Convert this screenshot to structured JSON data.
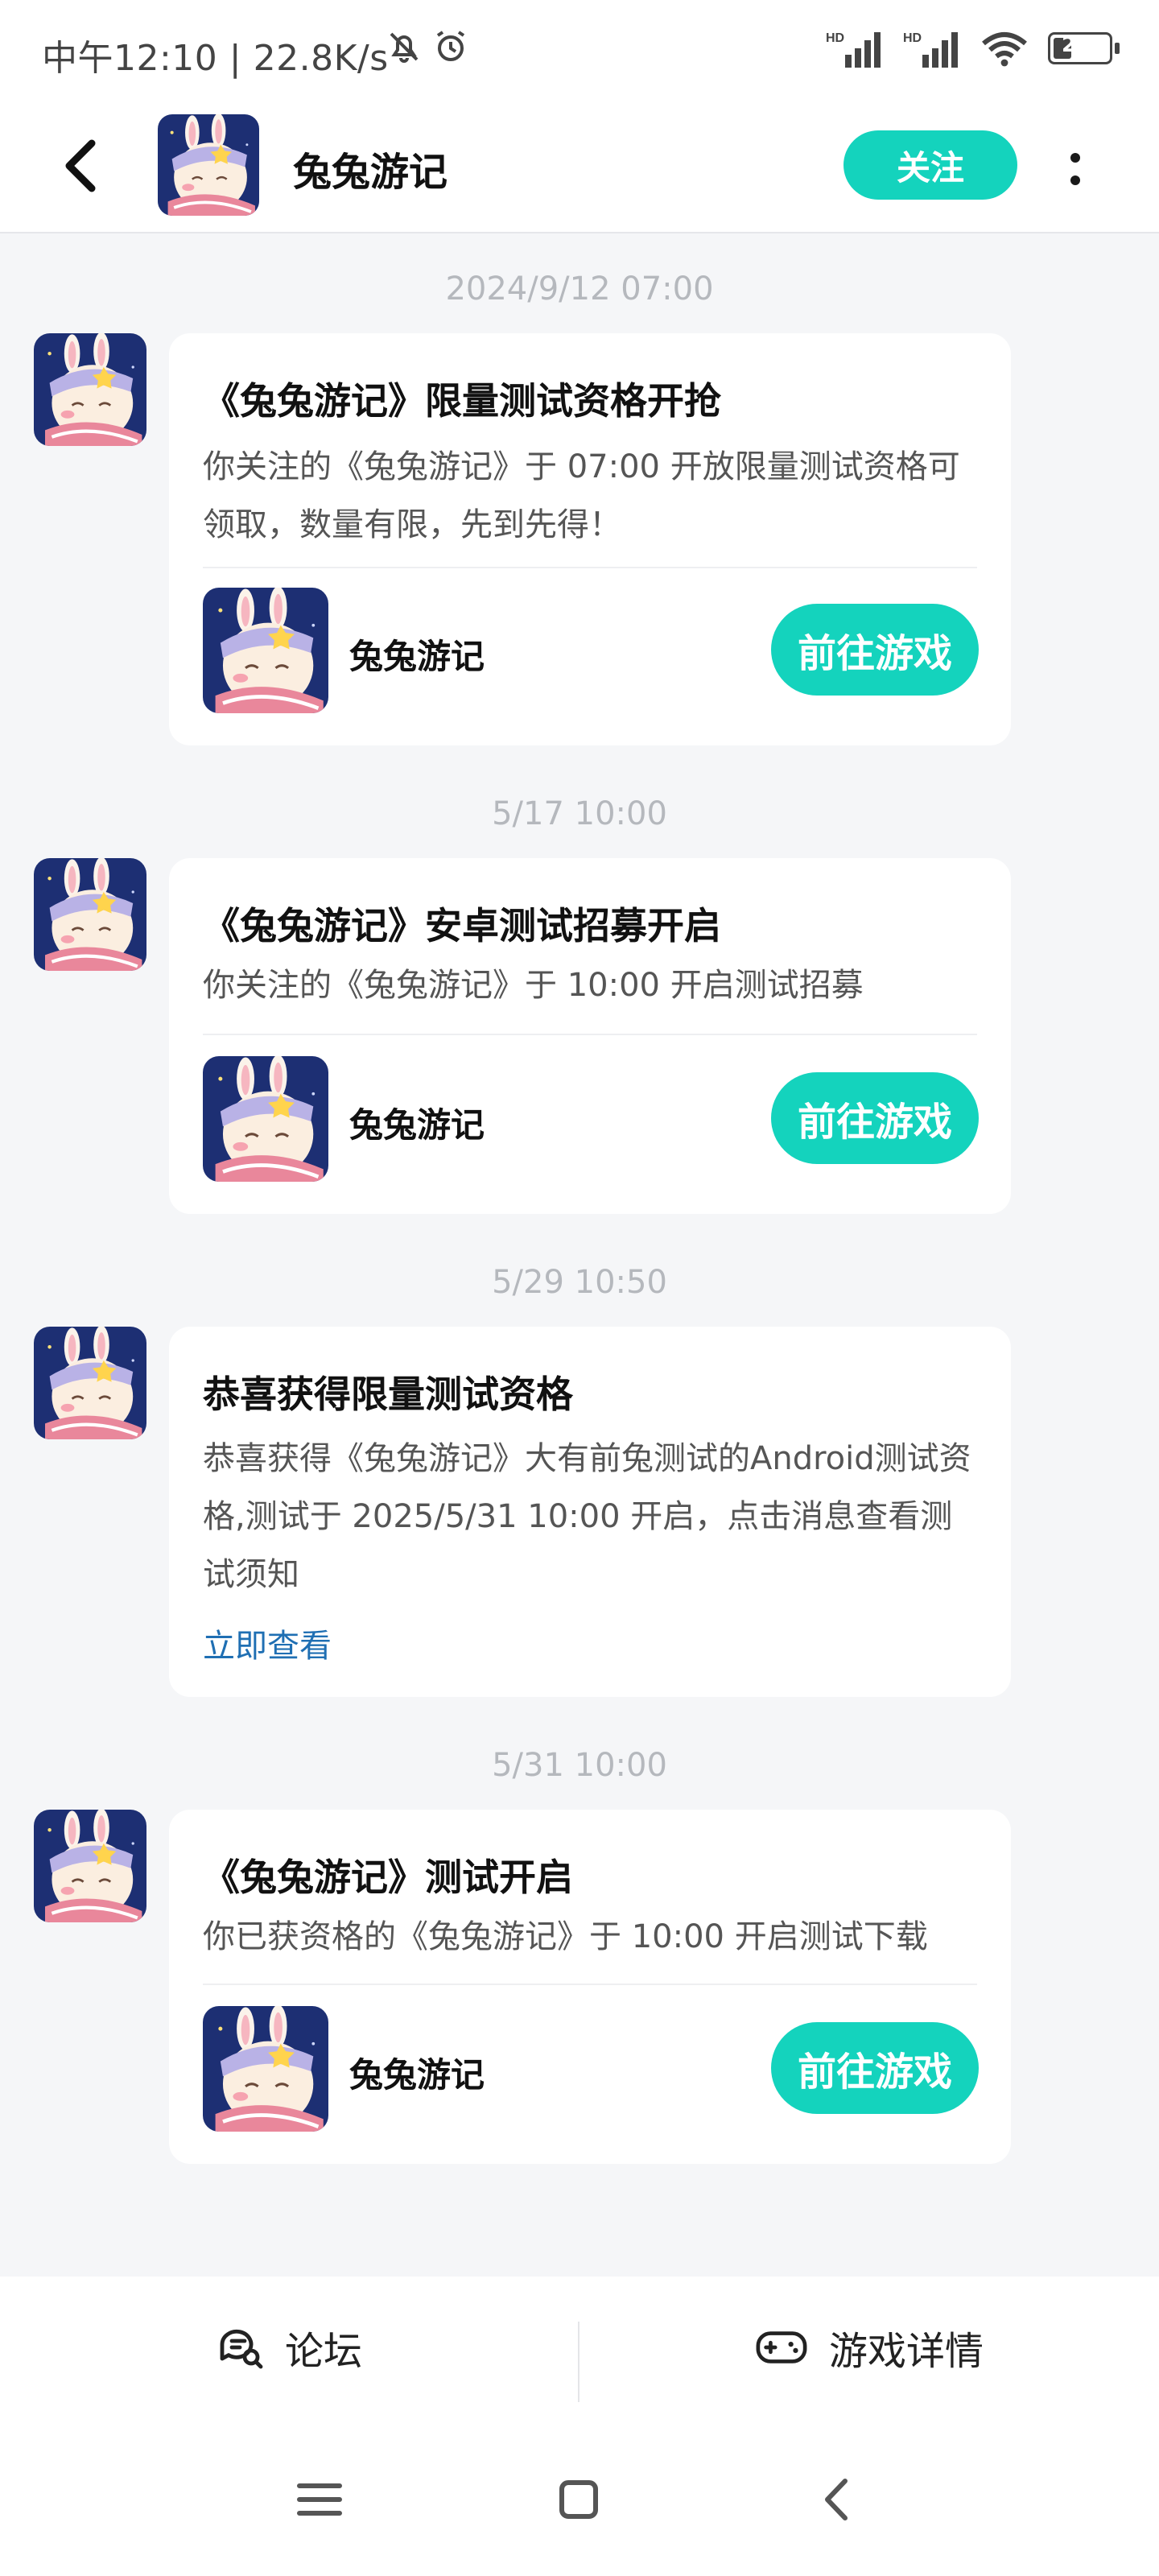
{
  "status_bar": {
    "time": "中午12:10 | 22.8K/s",
    "battery": "24",
    "icons": [
      "mute-bell-icon",
      "alarm-icon",
      "hd-signal-icon",
      "hd-signal-icon",
      "wifi-icon",
      "battery-icon"
    ]
  },
  "header": {
    "title": "兔兔游记",
    "follow_label": "关注"
  },
  "messages": [
    {
      "time": "2024/9/12  07:00",
      "title": "《兔兔游记》限量测试资格开抢",
      "body": "你关注的《兔兔游记》于 07:00 开放限量测试资格可领取，数量有限，先到先得！",
      "game_name": "兔兔游记",
      "button": "前往游戏"
    },
    {
      "time": "5/17  10:00",
      "title": "《兔兔游记》安卓测试招募开启",
      "body": "你关注的《兔兔游记》于 10:00 开启测试招募",
      "game_name": "兔兔游记",
      "button": "前往游戏"
    },
    {
      "time": "5/29  10:50",
      "title": "恭喜获得限量测试资格",
      "body": "恭喜获得《兔兔游记》大有前兔测试的Android测试资格,测试于 2025/5/31 10:00 开启，点击消息查看测试须知",
      "link": "立即查看"
    },
    {
      "time": "5/31  10:00",
      "title": "《兔兔游记》测试开启",
      "body": "你已获资格的《兔兔游记》于 10:00 开启测试下载",
      "game_name": "兔兔游记",
      "button": "前往游戏"
    }
  ],
  "bottom_tabs": {
    "forum": "论坛",
    "game_detail": "游戏详情"
  },
  "colors": {
    "accent": "#14d3bd",
    "link": "#1f6fb3",
    "background": "#f5f6f8"
  }
}
